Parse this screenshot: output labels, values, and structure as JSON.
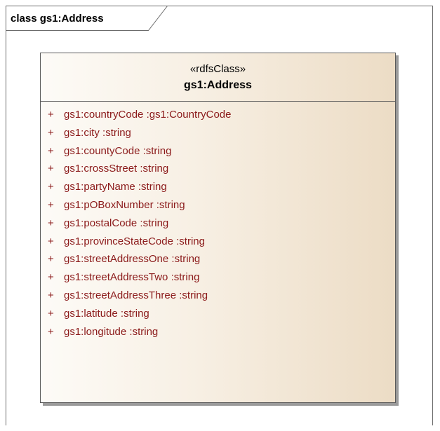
{
  "frame": {
    "title": "class gs1:Address"
  },
  "class": {
    "stereotype": "«rdfsClass»",
    "name": "gs1:Address",
    "attributes": [
      {
        "visibility": "+",
        "name": "gs1:countryCode",
        "type": ":gs1:CountryCode"
      },
      {
        "visibility": "+",
        "name": "gs1:city",
        "type": ":string"
      },
      {
        "visibility": "+",
        "name": "gs1:countyCode",
        "type": ":string"
      },
      {
        "visibility": "+",
        "name": "gs1:crossStreet",
        "type": ":string"
      },
      {
        "visibility": "+",
        "name": "gs1:partyName",
        "type": ":string"
      },
      {
        "visibility": "+",
        "name": "gs1:pOBoxNumber",
        "type": ":string"
      },
      {
        "visibility": "+",
        "name": "gs1:postalCode",
        "type": ":string"
      },
      {
        "visibility": "+",
        "name": "gs1:provinceStateCode",
        "type": ":string"
      },
      {
        "visibility": "+",
        "name": "gs1:streetAddressOne",
        "type": ":string"
      },
      {
        "visibility": "+",
        "name": "gs1:streetAddressTwo",
        "type": ":string"
      },
      {
        "visibility": "+",
        "name": "gs1:streetAddressThree",
        "type": ":string"
      },
      {
        "visibility": "+",
        "name": "gs1:latitude",
        "type": ":string"
      },
      {
        "visibility": "+",
        "name": "gs1:longitude",
        "type": ":string"
      }
    ]
  },
  "colors": {
    "attribute_text": "#8b1a1a",
    "border": "#5a5a5a",
    "fill_light": "#fdfbf7",
    "fill_dark": "#ecdcc5"
  }
}
